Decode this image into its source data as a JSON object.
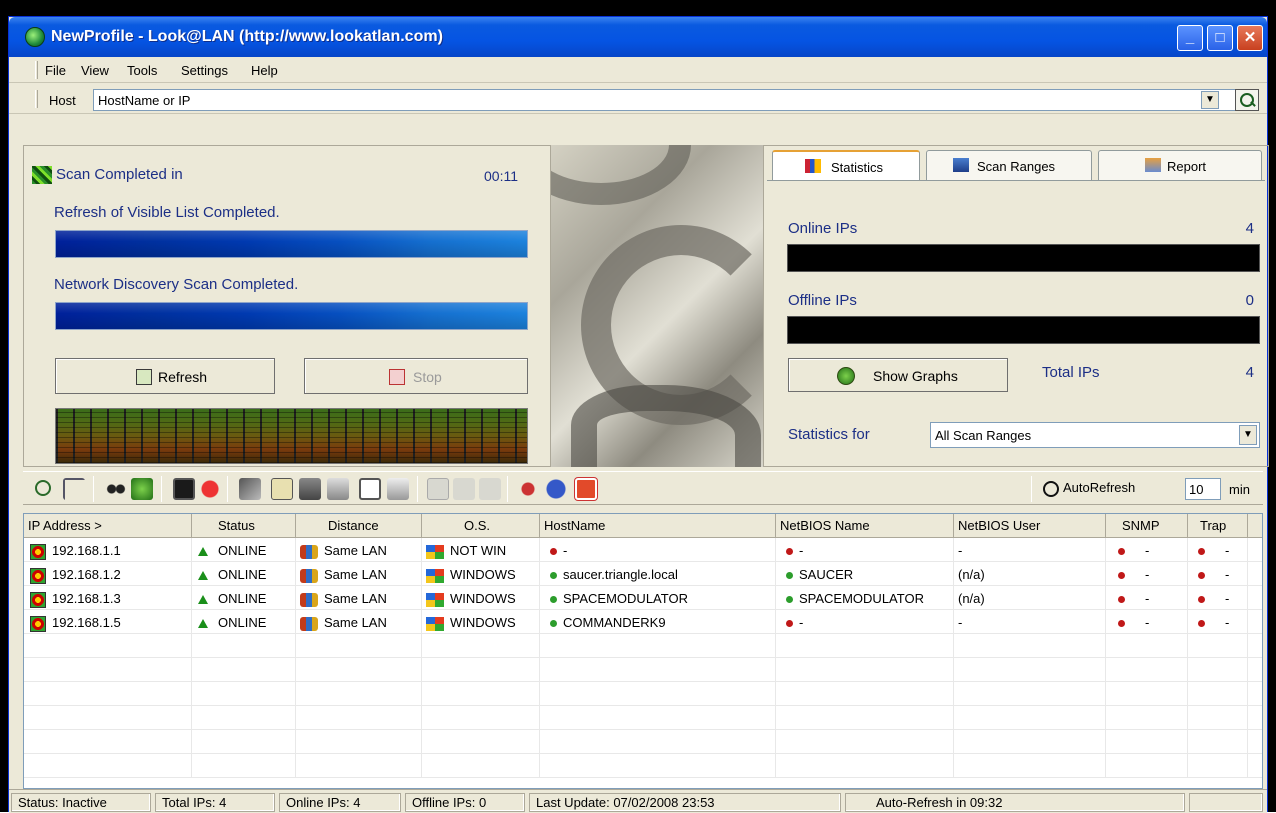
{
  "window": {
    "title": "NewProfile - Look@LAN (http://www.lookatlan.com)"
  },
  "menu": [
    "File",
    "View",
    "Tools",
    "Settings",
    "Help"
  ],
  "host": {
    "label": "Host",
    "value": "HostName or IP"
  },
  "scan": {
    "completed_label": "Scan Completed in",
    "time": "00:11",
    "refresh_label": "Refresh of Visible List Completed.",
    "refresh_progress": 1.0,
    "discovery_label": "Network Discovery Scan Completed.",
    "discovery_progress": 1.0,
    "refresh_button": "Refresh",
    "stop_button": "Stop"
  },
  "tabs": {
    "statistics": "Statistics",
    "scan_ranges": "Scan Ranges",
    "report": "Report"
  },
  "stats": {
    "online_label": "Online IPs",
    "online_value": "4",
    "offline_label": "Offline IPs",
    "offline_value": "0",
    "show_graphs": "Show Graphs",
    "total_label": "Total IPs",
    "total_value": "4",
    "stats_for_label": "Statistics for",
    "stats_for_value": "All Scan Ranges"
  },
  "toolbar": {
    "autorefresh_label": "AutoRefresh",
    "autorefresh_value": "10",
    "min_label": "min"
  },
  "grid": {
    "columns": [
      "IP Address >",
      "Status",
      "Distance",
      "O.S.",
      "HostName",
      "NetBIOS Name",
      "NetBIOS User",
      "SNMP",
      "Trap"
    ],
    "rows": [
      {
        "ip": "192.168.1.1",
        "status": "ONLINE",
        "distance": "Same LAN",
        "os": "NOT WIN",
        "host": "-",
        "host_ok": false,
        "nb_name": "-",
        "nb_ok": false,
        "nb_user": "-",
        "snmp": "-",
        "trap": "-"
      },
      {
        "ip": "192.168.1.2",
        "status": "ONLINE",
        "distance": "Same LAN",
        "os": "WINDOWS",
        "host": "saucer.triangle.local",
        "host_ok": true,
        "nb_name": "SAUCER",
        "nb_ok": true,
        "nb_user": "(n/a)",
        "snmp": "-",
        "trap": "-"
      },
      {
        "ip": "192.168.1.3",
        "status": "ONLINE",
        "distance": "Same LAN",
        "os": "WINDOWS",
        "host": "SPACEMODULATOR",
        "host_ok": true,
        "nb_name": "SPACEMODULATOR",
        "nb_ok": true,
        "nb_user": "(n/a)",
        "snmp": "-",
        "trap": "-"
      },
      {
        "ip": "192.168.1.5",
        "status": "ONLINE",
        "distance": "Same LAN",
        "os": "WINDOWS",
        "host": "COMMANDERK9",
        "host_ok": true,
        "nb_name": "-",
        "nb_ok": false,
        "nb_user": "-",
        "snmp": "-",
        "trap": "-"
      }
    ]
  },
  "statusbar": {
    "status": "Status: Inactive",
    "total": "Total IPs: 4",
    "online": "Online IPs: 4",
    "offline": "Offline IPs: 0",
    "last_update": "Last Update: 07/02/2008 23:53",
    "auto_refresh": "Auto-Refresh in 09:32"
  },
  "colors": {
    "accent_blue": "#1c2f86",
    "online": "#2c9d2c",
    "offline": "#c01818"
  }
}
